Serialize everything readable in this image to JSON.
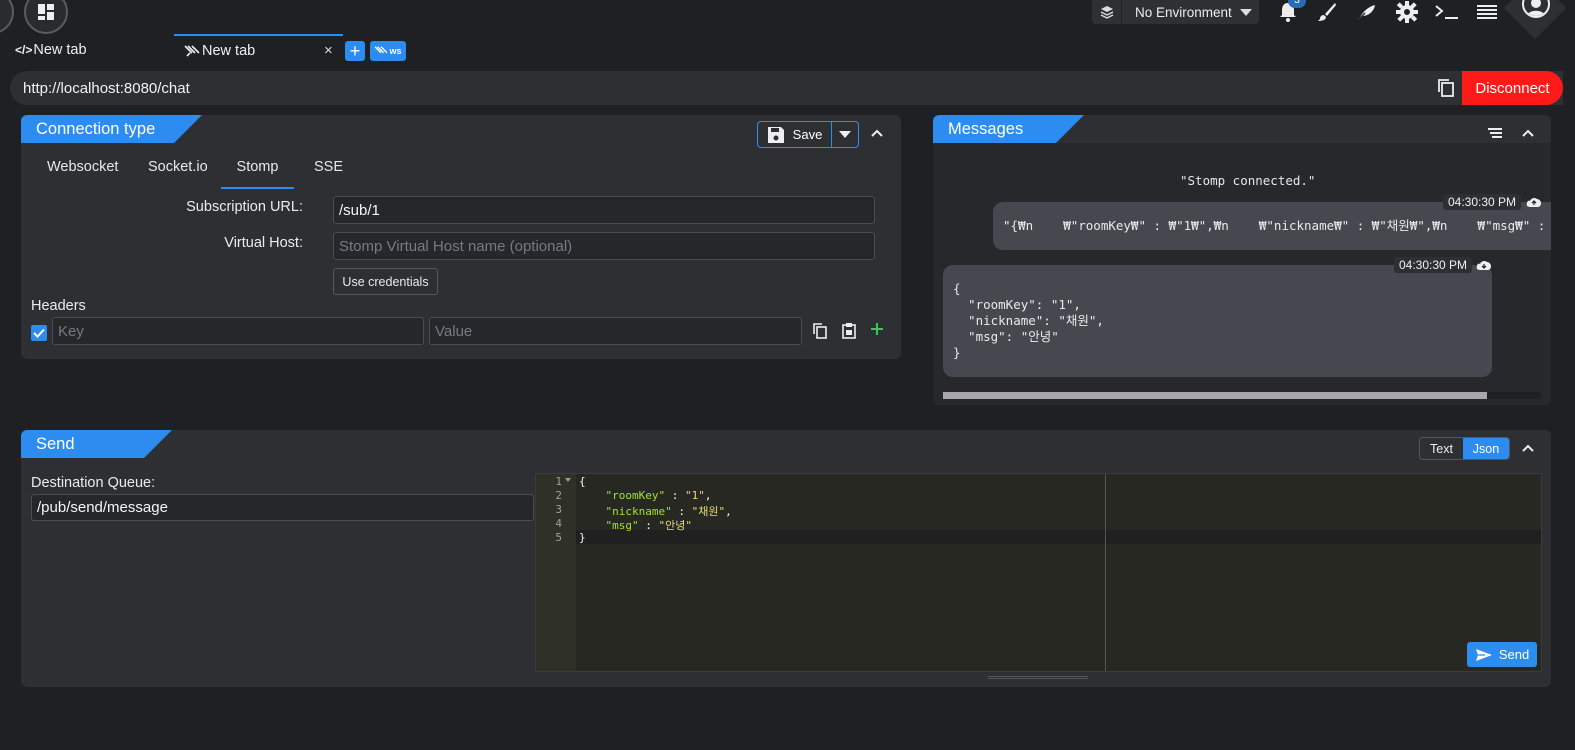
{
  "topbar": {
    "environment": "No Environment",
    "notification_count": "3"
  },
  "tabs": [
    {
      "label": "New tab",
      "type": "rest"
    },
    {
      "label": "New tab",
      "type": "socket"
    }
  ],
  "tab_close": "×",
  "ws_label": "ws",
  "url": {
    "value": "http://localhost:8080/chat",
    "disconnect_label": "Disconnect"
  },
  "connection": {
    "title": "Connection type",
    "save_label": "Save",
    "tabs": [
      "Websocket",
      "Socket.io",
      "Stomp",
      "SSE"
    ],
    "active_tab": "Stomp",
    "subscription_label": "Subscription URL:",
    "subscription_value": "/sub/1",
    "virtual_host_label": "Virtual Host:",
    "virtual_host_placeholder": "Stomp Virtual Host name (optional)",
    "credentials_label": "Use credentials",
    "headers_label": "Headers",
    "key_placeholder": "Key",
    "value_placeholder": "Value"
  },
  "messages": {
    "title": "Messages",
    "system": "\"Stomp connected.\"",
    "sent_time": "04:30:30 PM",
    "sent_text": "\"{₩n    ₩\"roomKey₩\" : ₩\"1₩\",₩n    ₩\"nickname₩\" : ₩\"채원₩\",₩n    ₩\"msg₩\" : ₩\"안",
    "recv_time": "04:30:30 PM",
    "recv_lines": [
      "{",
      "  \"roomKey\": \"1\",",
      "  \"nickname\": \"채원\",",
      "  \"msg\": \"안녕\"",
      "}"
    ]
  },
  "send": {
    "title": "Send",
    "mode_text": "Text",
    "mode_json": "Json",
    "active_mode": "Json",
    "destination_label": "Destination Queue:",
    "destination_value": "/pub/send/message",
    "line_numbers": [
      "1",
      "2",
      "3",
      "4",
      "5"
    ],
    "code": {
      "l1": "{",
      "l2_key": "\"roomKey\"",
      "l2_sep": " : ",
      "l2_val": "\"1\"",
      "l2_end": ",",
      "l3_key": "\"nickname\"",
      "l3_sep": " : ",
      "l3_val": "\"채원\"",
      "l3_end": ",",
      "l4_key": "\"msg\"",
      "l4_sep": " : ",
      "l4_val": "\"안녕\"",
      "l5": "}"
    },
    "send_label": "Send"
  },
  "colors": {
    "accent": "#2d8cf0",
    "danger": "#ff1a1a",
    "panel": "#2d2f33",
    "background": "#1f2023"
  }
}
